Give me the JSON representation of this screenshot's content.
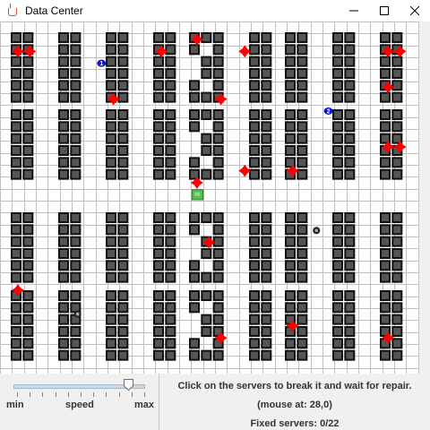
{
  "window": {
    "title": "Data Center",
    "controls": [
      "minimize",
      "maximize",
      "close"
    ]
  },
  "grid": {
    "racks": [
      {
        "row": 0,
        "col": 0,
        "pattern": "single"
      },
      {
        "row": 0,
        "col": 1,
        "pattern": "single"
      },
      {
        "row": 0,
        "col": 2,
        "pattern": "single"
      },
      {
        "row": 0,
        "col": 3,
        "pattern": "single"
      },
      {
        "row": 0,
        "col": 4,
        "pattern": "ring"
      },
      {
        "row": 0,
        "col": 5,
        "pattern": "single"
      },
      {
        "row": 0,
        "col": 6,
        "pattern": "single"
      },
      {
        "row": 0,
        "col": 7,
        "pattern": "single"
      },
      {
        "row": 0,
        "col": 8,
        "pattern": "single"
      },
      {
        "row": 1,
        "col": 0,
        "pattern": "single"
      },
      {
        "row": 1,
        "col": 1,
        "pattern": "single"
      },
      {
        "row": 1,
        "col": 2,
        "pattern": "single"
      },
      {
        "row": 1,
        "col": 3,
        "pattern": "single"
      },
      {
        "row": 1,
        "col": 4,
        "pattern": "ring"
      },
      {
        "row": 1,
        "col": 5,
        "pattern": "single"
      },
      {
        "row": 1,
        "col": 6,
        "pattern": "single"
      },
      {
        "row": 1,
        "col": 7,
        "pattern": "single"
      },
      {
        "row": 1,
        "col": 8,
        "pattern": "single"
      },
      {
        "row": 2,
        "col": 0,
        "pattern": "single"
      },
      {
        "row": 2,
        "col": 1,
        "pattern": "single"
      },
      {
        "row": 2,
        "col": 2,
        "pattern": "single"
      },
      {
        "row": 2,
        "col": 3,
        "pattern": "single"
      },
      {
        "row": 2,
        "col": 4,
        "pattern": "ring"
      },
      {
        "row": 2,
        "col": 5,
        "pattern": "single"
      },
      {
        "row": 2,
        "col": 6,
        "pattern": "single"
      },
      {
        "row": 2,
        "col": 7,
        "pattern": "single"
      },
      {
        "row": 2,
        "col": 8,
        "pattern": "single"
      },
      {
        "row": 3,
        "col": 0,
        "pattern": "single"
      },
      {
        "row": 3,
        "col": 1,
        "pattern": "single"
      },
      {
        "row": 3,
        "col": 2,
        "pattern": "single"
      },
      {
        "row": 3,
        "col": 3,
        "pattern": "single"
      },
      {
        "row": 3,
        "col": 4,
        "pattern": "ring"
      },
      {
        "row": 3,
        "col": 5,
        "pattern": "single"
      },
      {
        "row": 3,
        "col": 6,
        "pattern": "single"
      },
      {
        "row": 3,
        "col": 7,
        "pattern": "single"
      },
      {
        "row": 3,
        "col": 8,
        "pattern": "single"
      }
    ],
    "broken_servers": [
      {
        "col": 1,
        "row": 2
      },
      {
        "col": 2,
        "row": 2
      },
      {
        "col": 13,
        "row": 2
      },
      {
        "col": 16,
        "row": 1
      },
      {
        "col": 20,
        "row": 2
      },
      {
        "col": 32,
        "row": 2
      },
      {
        "col": 33,
        "row": 2
      },
      {
        "col": 9,
        "row": 6
      },
      {
        "col": 18,
        "row": 6
      },
      {
        "col": 32,
        "row": 5
      },
      {
        "col": 32,
        "row": 10
      },
      {
        "col": 33,
        "row": 10
      },
      {
        "col": 20,
        "row": 12
      },
      {
        "col": 24,
        "row": 12
      },
      {
        "col": 16,
        "row": 13
      },
      {
        "col": 17,
        "row": 18
      },
      {
        "col": 1,
        "row": 22
      },
      {
        "col": 24,
        "row": 25
      },
      {
        "col": 18,
        "row": 26
      },
      {
        "col": 32,
        "row": 26
      }
    ],
    "robots": [
      {
        "col": 8,
        "row": 3,
        "number": "1"
      },
      {
        "col": 27,
        "row": 7,
        "number": "2"
      }
    ],
    "repair_tokens": [
      {
        "col": 26,
        "row": 17
      },
      {
        "col": 6,
        "row": 24
      }
    ],
    "home_base": {
      "col": 16,
      "row": 14
    },
    "colors": {
      "background": "#ffffff",
      "gridline": "#c0c0c0",
      "rack_border": "#111111",
      "rack_fill": "#555555",
      "broken": "#ff0000",
      "robot": "#1010dd",
      "home_base": "#55bb55"
    }
  },
  "speed_slider": {
    "min_label": "min",
    "speed_label": "speed",
    "max_label": "max",
    "value_fraction": 0.88
  },
  "info": {
    "instruction": "Click on the servers to break it and wait for repair.",
    "mouse_at": "(mouse at: 28,0)",
    "fixed": "Fixed servers: 0/22"
  }
}
